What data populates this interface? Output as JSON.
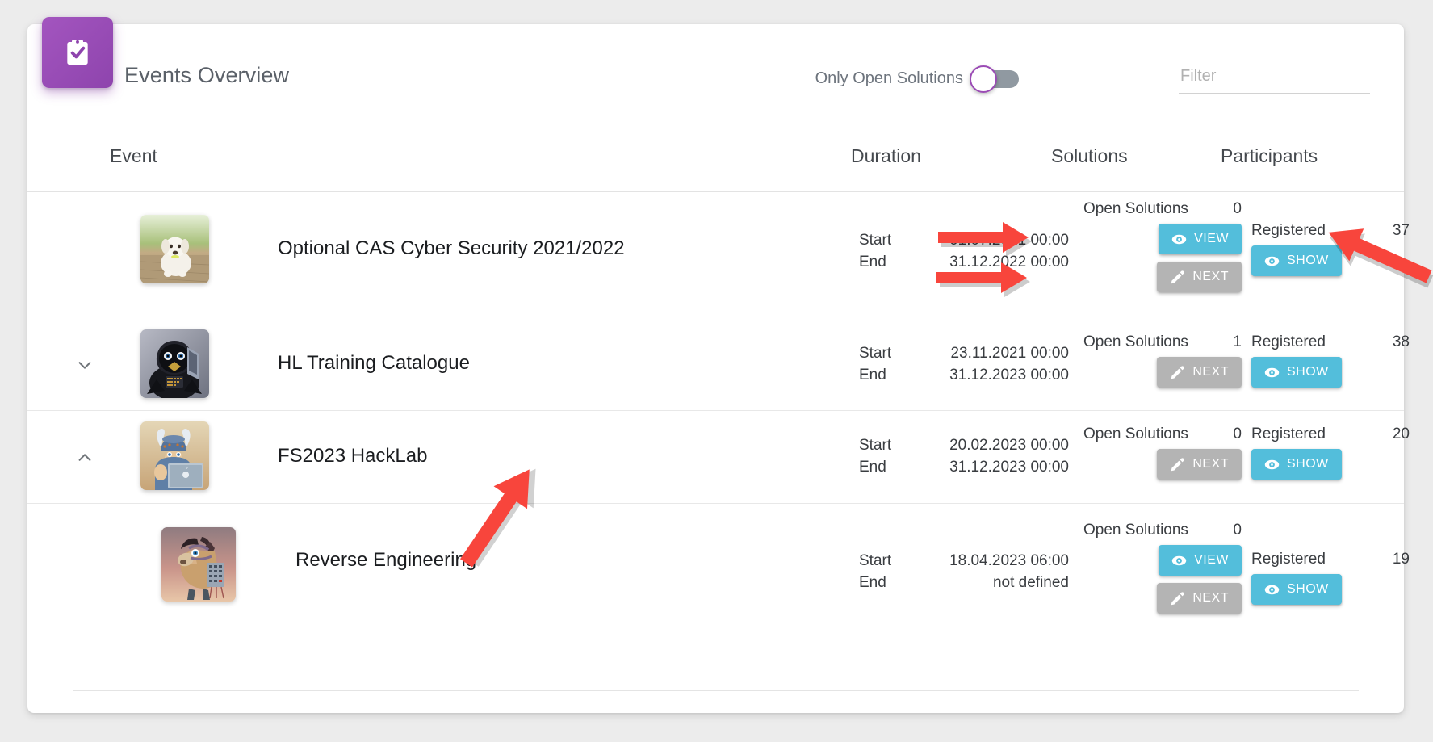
{
  "header": {
    "title": "Events Overview",
    "badge_icon": "clipboard-check-icon",
    "toggle_label": "Only Open Solutions",
    "toggle_state": "off",
    "filter_placeholder": "Filter",
    "filter_value": ""
  },
  "columns": {
    "event": "Event",
    "duration": "Duration",
    "solutions": "Solutions",
    "participants": "Participants"
  },
  "labels": {
    "start": "Start",
    "end": "End",
    "open_solutions": "Open Solutions",
    "registered": "Registered",
    "view": "VIEW",
    "next": "NEXT",
    "show": "SHOW"
  },
  "colors": {
    "accent_purple": "#8e44ad",
    "button_teal": "#53bedb",
    "button_gray": "#b4b4b4",
    "annotation_red": "#f8453c",
    "page_background": "#ececec",
    "card_background": "#ffffff"
  },
  "rows": [
    {
      "title": "Optional CAS Cyber Security 2021/2022",
      "thumbnail": "white-puppy-on-wooden-deck-image",
      "chevron": "",
      "start_value": "01.07.2021 00:00",
      "end_value": "31.12.2022 00:00",
      "open_solutions_count": "0",
      "registered_count": "37",
      "solution_buttons": [
        "VIEW",
        "NEXT"
      ],
      "participant_buttons": [
        "SHOW"
      ]
    },
    {
      "title": "HL Training Catalogue",
      "thumbnail": "hooded-raven-hacker-image",
      "chevron": "chevron-down-icon",
      "start_value": "23.11.2021 00:00",
      "end_value": "31.12.2023 00:00",
      "open_solutions_count": "1",
      "registered_count": "38",
      "solution_buttons": [
        "NEXT"
      ],
      "participant_buttons": [
        "SHOW"
      ]
    },
    {
      "title": "FS2023 HackLab",
      "thumbnail": "viking-with-laptop-image",
      "chevron": "chevron-up-icon",
      "start_value": "20.02.2023 00:00",
      "end_value": "31.12.2023 00:00",
      "open_solutions_count": "0",
      "registered_count": "20",
      "solution_buttons": [
        "NEXT"
      ],
      "participant_buttons": [
        "SHOW"
      ]
    },
    {
      "title": "Reverse Engineering",
      "thumbnail": "trojan-horse-image",
      "chevron": "",
      "start_value": "18.04.2023 06:00",
      "end_value": "not defined",
      "open_solutions_count": "0",
      "registered_count": "19",
      "solution_buttons": [
        "VIEW",
        "NEXT"
      ],
      "participant_buttons": [
        "SHOW"
      ]
    }
  ],
  "annotations": [
    {
      "name": "arrow-pointing-to-view-button"
    },
    {
      "name": "arrow-pointing-to-next-button"
    },
    {
      "name": "arrow-pointing-to-show-button"
    },
    {
      "name": "arrow-pointing-to-reverse-engineering-title"
    }
  ]
}
